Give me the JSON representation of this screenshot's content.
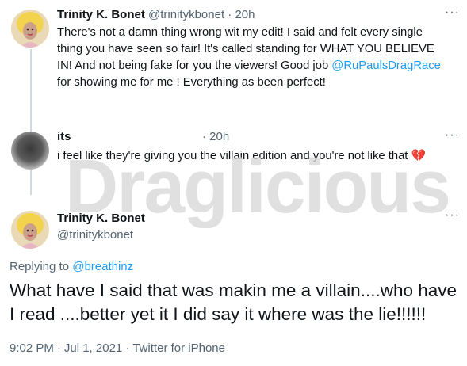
{
  "tweet1": {
    "name": "Trinity K. Bonet",
    "handle": "@trinitykbonet",
    "separator": "·",
    "time": "20h",
    "more": "···",
    "text_before": "There's not a damn thing wrong wit my edit! I said and felt every single thing you have seen so fair! It's called standing for WHAT YOU BELIEVE IN! And not being fake for you the viewers! Good job ",
    "mention": "@RuPaulsDragRace",
    "text_after": " for showing me for me ! Everything as been perfect!"
  },
  "tweet2": {
    "name": "its",
    "time": "· 20h",
    "more": "···",
    "text": "i feel like they're giving you the villain edition and you're not like that",
    "emoji": "💔"
  },
  "tweet3": {
    "name": "Trinity K. Bonet",
    "handle": "@trinitykbonet",
    "more": "···",
    "replying_label": "Replying to",
    "replying_to": "@breathinz",
    "text": "What have I said that was makin me a villain....who have I read ....better yet it I did say it where was the lie!!!!!!",
    "time": "9:02 PM",
    "date": "Jul 1, 2021",
    "source": "Twitter for iPhone",
    "separator": "·"
  },
  "watermark": {
    "text": "Draglicious",
    "color": "#d6d6d6"
  },
  "colors": {
    "text": "#0f1419",
    "secondary": "#536471",
    "link": "#1d9bf0",
    "thread_line": "#cfd9de"
  }
}
